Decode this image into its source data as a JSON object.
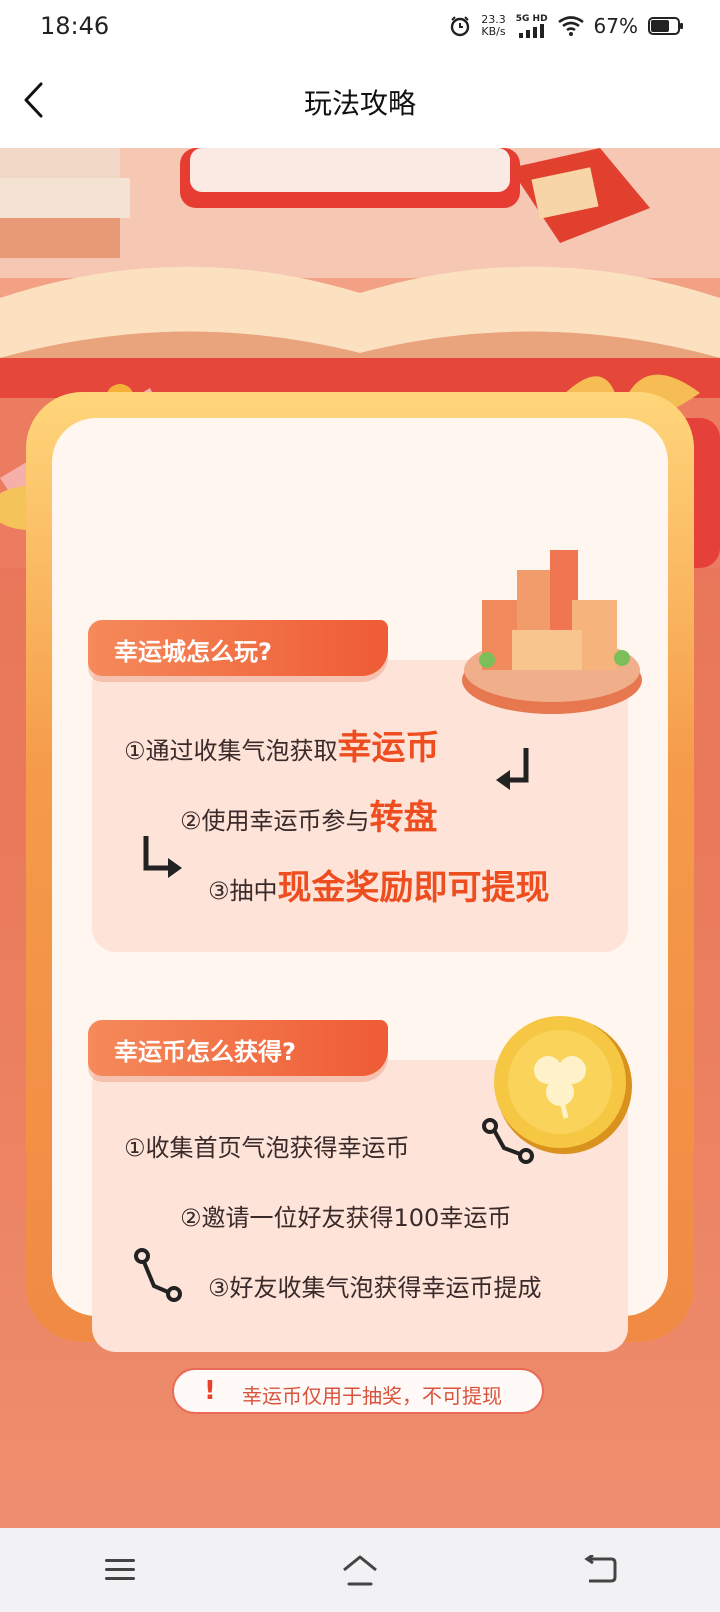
{
  "status_bar": {
    "time": "18:46",
    "net_speed_value": "23.3",
    "net_speed_unit": "KB/s",
    "network_type": "5G HD",
    "battery": "67%"
  },
  "nav": {
    "title": "玩法攻略"
  },
  "section1": {
    "heading": "幸运城怎么玩?",
    "steps": [
      {
        "prefix": "①通过收集气泡获取",
        "highlight": "幸运币"
      },
      {
        "prefix": "②使用幸运币参与",
        "highlight": "转盘"
      },
      {
        "prefix": "③抽中",
        "highlight": "现金奖励即可提现"
      }
    ]
  },
  "section2": {
    "heading": "幸运币怎么获得?",
    "steps": [
      "①收集首页气泡获得幸运币",
      "②邀请一位好友获得100幸运币",
      "③好友收集气泡获得幸运币提成"
    ]
  },
  "notice": {
    "mark": "!",
    "text": "幸运币仅用于抽奖，不可提现"
  },
  "icons": {
    "back": "chevron-left-icon",
    "menu": "menu-icon",
    "home": "home-icon",
    "back_nav": "return-icon"
  }
}
